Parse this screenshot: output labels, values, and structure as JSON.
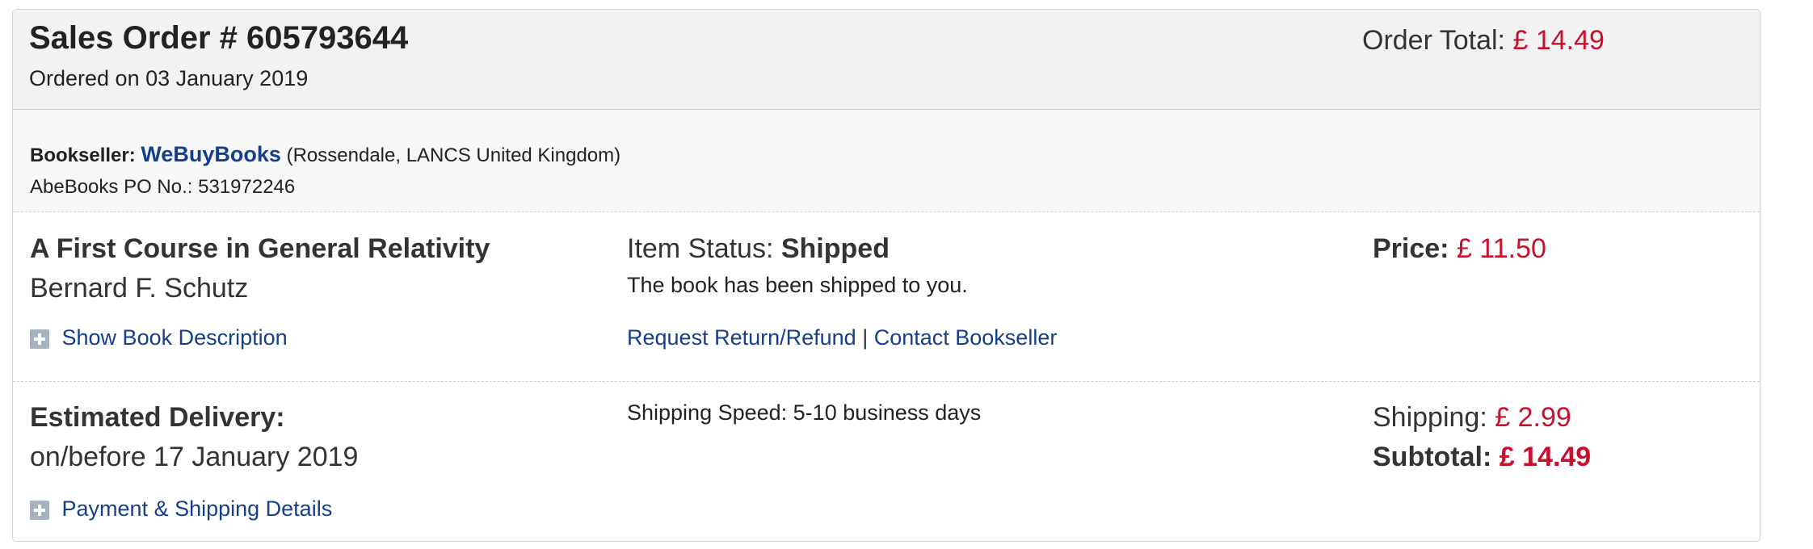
{
  "order": {
    "title": "Sales Order # 605793644",
    "ordered_on": "Ordered on 03 January 2019",
    "total_label": "Order Total:",
    "total_value": "£ 14.49"
  },
  "seller": {
    "label": "Bookseller:",
    "name": "WeBuyBooks",
    "location": "(Rossendale, LANCS United Kingdom)",
    "po": "AbeBooks PO No.: 531972246"
  },
  "item": {
    "title": "A First Course in General Relativity",
    "author": "Bernard F. Schutz",
    "show_description": "Show Book Description",
    "status_label": "Item Status:",
    "status_value": "Shipped",
    "status_desc": "The book has been shipped to you.",
    "return_link": "Request Return/Refund",
    "separator": "|",
    "contact_link": "Contact Bookseller",
    "price_label": "Price:",
    "price_value": "£ 11.50"
  },
  "delivery": {
    "label": "Estimated Delivery:",
    "date": "on/before 17 January 2019",
    "payment_details": "Payment & Shipping Details",
    "shipping_speed": "Shipping Speed: 5-10 business days",
    "shipping_label": "Shipping:",
    "shipping_value": "£ 2.99",
    "subtotal_label": "Subtotal:",
    "subtotal_value": "£ 14.49"
  },
  "colors": {
    "price_red": "#c8102e",
    "link_blue": "#153e8c",
    "header_bg": "#f2f2f2"
  },
  "icons": [
    "plus-icon"
  ]
}
